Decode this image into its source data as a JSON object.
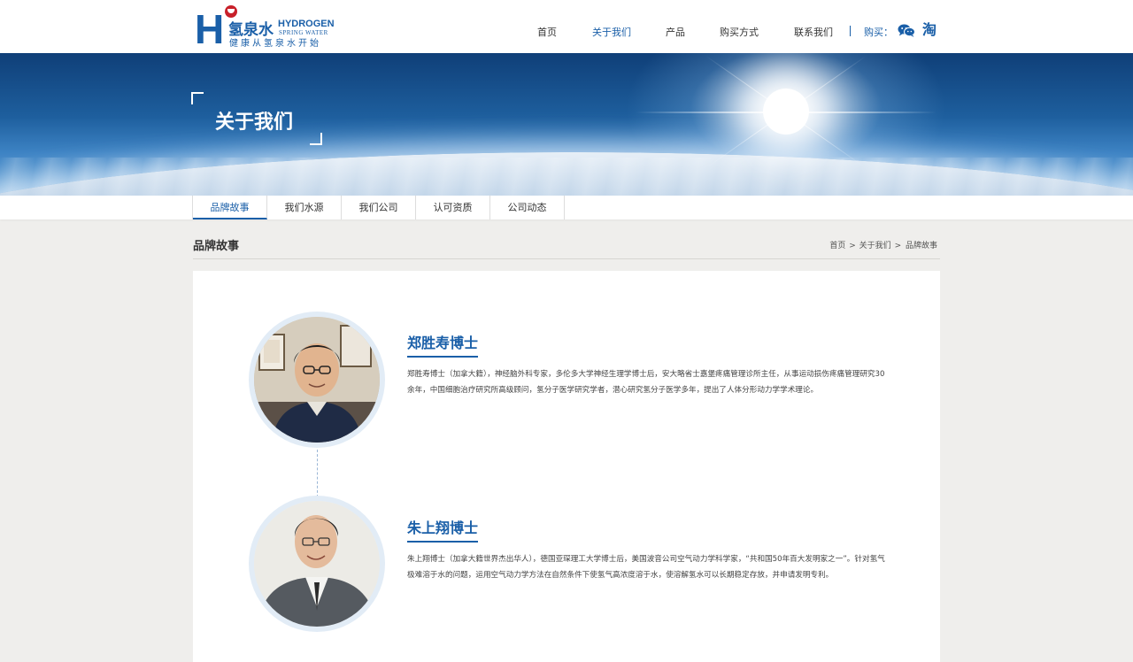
{
  "header": {
    "logo": {
      "letter": "H",
      "cn": "氢泉水",
      "en_line1": "HYDROGEN",
      "en_line2": "SPRING WATER",
      "slogan": "健康从氢泉水开始"
    },
    "nav": [
      {
        "label": "首页",
        "active": false
      },
      {
        "label": "关于我们",
        "active": true
      },
      {
        "label": "产品",
        "active": false
      },
      {
        "label": "购买方式",
        "active": false
      },
      {
        "label": "联系我们",
        "active": false
      }
    ],
    "buy_label": "购买：",
    "taobao_glyph": "淘",
    "icons": [
      "wechat-icon",
      "taobao-icon"
    ]
  },
  "banner": {
    "title": "关于我们"
  },
  "subnav": {
    "tabs": [
      {
        "label": "品牌故事",
        "active": true
      },
      {
        "label": "我们水源",
        "active": false
      },
      {
        "label": "我们公司",
        "active": false
      },
      {
        "label": "认可资质",
        "active": false
      },
      {
        "label": "公司动态",
        "active": false
      }
    ]
  },
  "section": {
    "title": "品牌故事",
    "breadcrumb": [
      "首页",
      "关于我们",
      "品牌故事"
    ],
    "breadcrumb_sep": ">"
  },
  "people": [
    {
      "name": "郑胜寿博士",
      "bio": "郑胜寿博士（加拿大籍），神经脑外科专家，多伦多大学神经生理学博士后，安大略省士嘉堡疼痛管理诊所主任，从事运动损伤疼痛管理研究30余年，中国细胞治疗研究所高级顾问，氢分子医学研究学者，潜心研究氢分子医学多年，提出了人体分形动力学学术理论。"
    },
    {
      "name": "朱上翔博士",
      "bio": "朱上翔博士（加拿大籍世界杰出华人），德国亚琛理工大学博士后，美国波音公司空气动力学科学家，“共和国50年百大发明家之一”。针对氢气极难溶于水的问题，运用空气动力学方法在自然条件下使氢气高浓度溶于水，使溶解氢水可以长期稳定存放，并申请发明专利。"
    }
  ],
  "colors": {
    "brand_blue": "#1a5fa8",
    "logo_red": "#c8202a",
    "page_bg": "#efeeec"
  }
}
